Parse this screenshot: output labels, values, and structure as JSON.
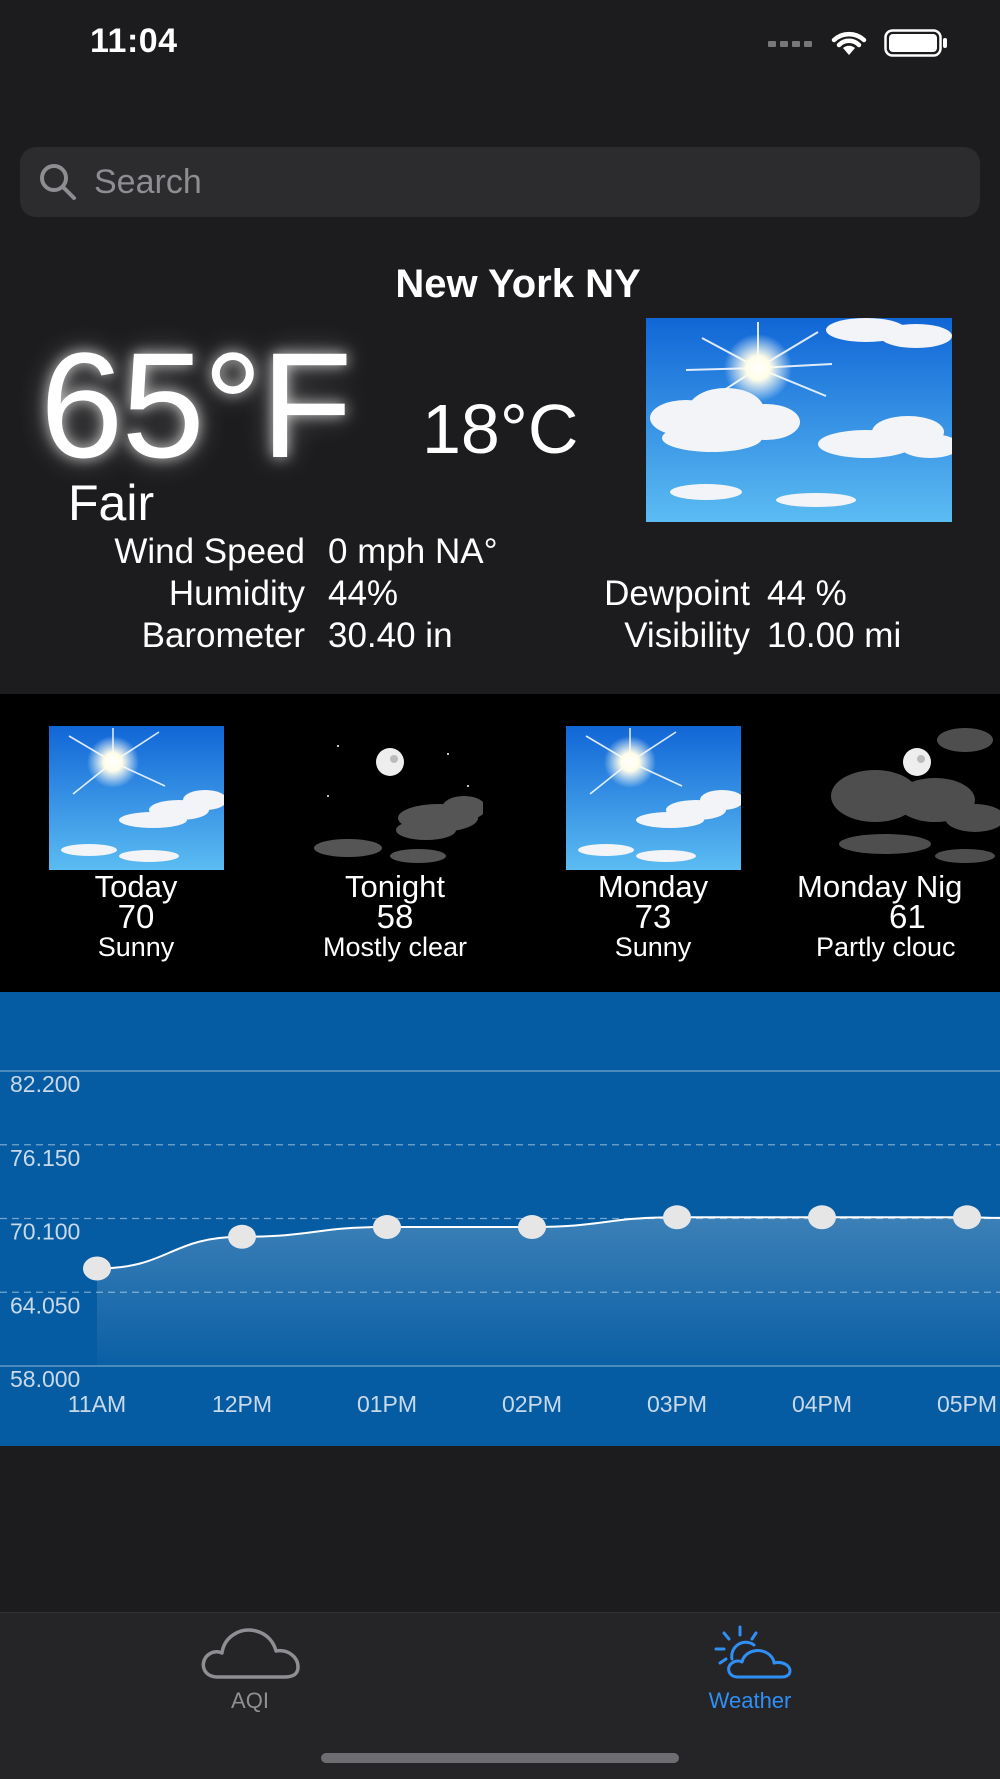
{
  "status": {
    "time": "11:04"
  },
  "search": {
    "placeholder": "Search"
  },
  "current": {
    "city": "New York NY",
    "temp_f": "65°F",
    "temp_c": "18°C",
    "condition": "Fair",
    "image_icon": "sunny-sky-image",
    "details": [
      {
        "label": "Wind Speed",
        "value": "0 mph NA°"
      },
      {
        "label": "Humidity",
        "value": "44%"
      },
      {
        "label": "Barometer",
        "value": "30.40 in"
      },
      {
        "label": "Dewpoint",
        "value": "44 %"
      },
      {
        "label": "Visibility",
        "value": "10.00 mi"
      }
    ]
  },
  "forecast": [
    {
      "period": "Today",
      "temp": "70",
      "desc": "Sunny",
      "icon": "sunny-day-icon"
    },
    {
      "period": "Tonight",
      "temp": "58",
      "desc": "Mostly clear",
      "icon": "clear-night-icon"
    },
    {
      "period": "Monday",
      "temp": "73",
      "desc": "Sunny",
      "icon": "sunny-day-icon"
    },
    {
      "period": "Monday Nig",
      "temp": "61",
      "desc": "Partly clouc",
      "icon": "cloudy-night-icon"
    }
  ],
  "chart_data": {
    "type": "line",
    "categories": [
      "11AM",
      "12PM",
      "01PM",
      "02PM",
      "03PM",
      "04PM",
      "05PM"
    ],
    "values": [
      66,
      68.6,
      69.4,
      69.4,
      70.2,
      70.2,
      70.2
    ],
    "ylim": [
      58,
      82.2
    ],
    "yticks": [
      "58.000",
      "64.050",
      "70.100",
      "76.150",
      "82.200"
    ],
    "fill": "area",
    "background": "#055ca3",
    "grid": true
  },
  "tabs": [
    {
      "label": "AQI",
      "icon": "cloud-icon",
      "active": false,
      "color": "#8e8e93"
    },
    {
      "label": "Weather",
      "icon": "sun-cloud-icon",
      "active": true,
      "color": "#2f8ff5"
    }
  ]
}
